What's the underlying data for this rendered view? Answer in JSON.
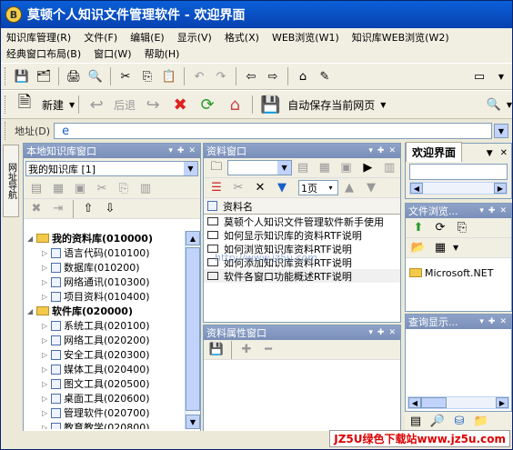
{
  "window": {
    "title": "莫顿个人知识文件管理软件 - 欢迎界面"
  },
  "menu": {
    "row1": [
      "知识库管理(R)",
      "文件(F)",
      "编辑(E)",
      "显示(V)",
      "格式(X)",
      "WEB浏览(W1)",
      "知识库WEB浏览(W2)"
    ],
    "row2": [
      "经典窗口布局(B)",
      "窗口(W)",
      "帮助(H)"
    ]
  },
  "toolbar2": {
    "new": "新建",
    "back": "后退",
    "autosave": "自动保存当前网页"
  },
  "address": {
    "label": "地址(D)",
    "value": ""
  },
  "sidetab": {
    "label": "网址导航"
  },
  "local_kb": {
    "title": "本地知识库窗口",
    "selector": "我的知识库 [1]",
    "tree": [
      {
        "label": "我的资料库(010000)",
        "level": 0,
        "type": "folder",
        "bold": true
      },
      {
        "label": "语言代码(010100)",
        "level": 1,
        "type": "doc"
      },
      {
        "label": "数据库(010200)",
        "level": 1,
        "type": "doc"
      },
      {
        "label": "网络通讯(010300)",
        "level": 1,
        "type": "doc"
      },
      {
        "label": "项目资料(010400)",
        "level": 1,
        "type": "doc"
      },
      {
        "label": "软件库(020000)",
        "level": 0,
        "type": "folder",
        "bold": true
      },
      {
        "label": "系统工具(020100)",
        "level": 1,
        "type": "doc"
      },
      {
        "label": "网络工具(020200)",
        "level": 1,
        "type": "doc"
      },
      {
        "label": "安全工具(020300)",
        "level": 1,
        "type": "doc"
      },
      {
        "label": "媒体工具(020400)",
        "level": 1,
        "type": "doc"
      },
      {
        "label": "图文工具(020500)",
        "level": 1,
        "type": "doc"
      },
      {
        "label": "桌面工具(020600)",
        "level": 1,
        "type": "doc"
      },
      {
        "label": "管理软件(020700)",
        "level": 1,
        "type": "doc"
      },
      {
        "label": "教育教学(020800)",
        "level": 1,
        "type": "doc"
      }
    ]
  },
  "resource": {
    "title": "资料窗口",
    "page_combo": "1页",
    "column": "资料名",
    "items": [
      "莫顿个人知识文件管理软件新手使用",
      "如何显示知识库的资料RTF说明",
      "如何浏览知识库资料RTF说明",
      "如何添加知识库资料RTF说明",
      "软件各窗口功能概述RTF说明"
    ],
    "overlay": "http://www.jz5u.com"
  },
  "props": {
    "title": "资料属性窗口"
  },
  "welcome": {
    "tab": "欢迎界面"
  },
  "filebrowser": {
    "title": "文件浏览...",
    "folder": "Microsoft.NET"
  },
  "query": {
    "title": "查询显示..."
  },
  "watermark": "JZ5U绿色下载站www.jz5u.com"
}
